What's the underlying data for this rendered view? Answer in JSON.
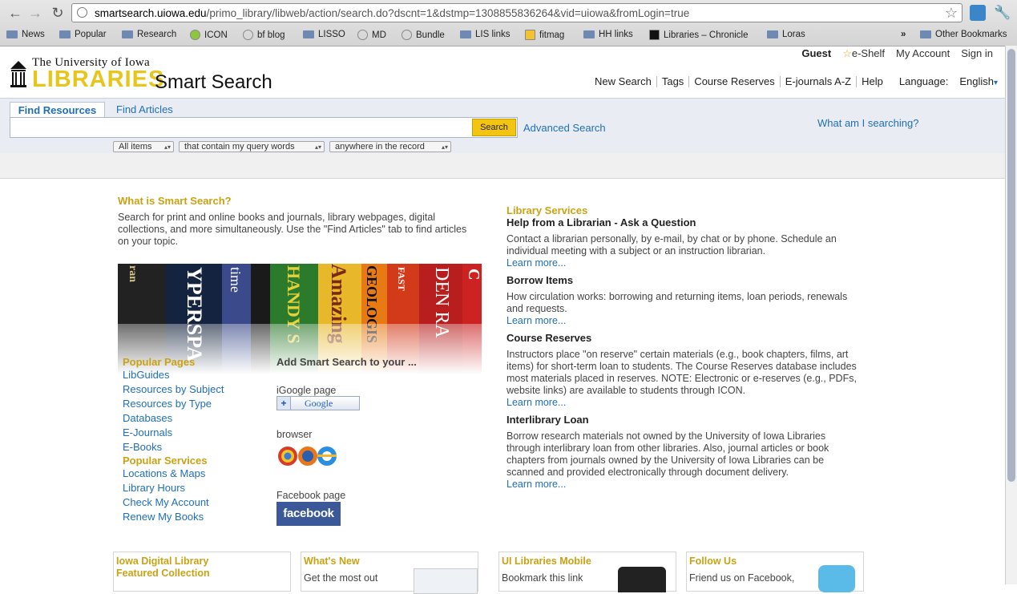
{
  "browser": {
    "url_host": "smartsearch.uiowa.edu",
    "url_rest": "/primo_library/libweb/action/search.do?dscnt=1&dstmp=1308855836264&vid=uiowa&fromLogin=true",
    "bookmarks": [
      "News",
      "Popular",
      "Research",
      "ICON",
      "bf blog",
      "LISSO",
      "MD",
      "Bundle",
      "LIS links",
      "fitmag",
      "HH links",
      "Libraries – Chronicle",
      "Loras"
    ],
    "other_bookmarks": "Other Bookmarks",
    "overflow": "»"
  },
  "header": {
    "uni_name": "The University of Iowa",
    "libraries": "LIBRARIES",
    "product": "Smart Search",
    "guest": "Guest",
    "eshelf": "e-Shelf",
    "my_account": "My Account",
    "sign_in": "Sign in",
    "nav": [
      "New Search",
      "Tags",
      "Course Reserves",
      "E-journals A-Z",
      "Help"
    ],
    "language_label": "Language:",
    "language_value": "English"
  },
  "search": {
    "tab_find": "Find Resources",
    "tab_articles": "Find Articles",
    "query": "",
    "button": "Search",
    "advanced": "Advanced Search",
    "what": "What am I searching?",
    "scope": "All items",
    "precision": "that contain my query words",
    "field": "anywhere in the record"
  },
  "intro": {
    "title": "What is Smart Search?",
    "text": "Search for print and online books and journals, library webpages, digital collections, and more simultaneously. Use the \"Find Articles\" tab to find articles on your topic."
  },
  "books": [
    "ran",
    "YPERSPA",
    "time",
    "HANDY S",
    "Amazing",
    "GEOLOGIS",
    "FAST",
    "DEN RA",
    "C"
  ],
  "popular_pages": {
    "title": "Popular Pages",
    "links": [
      "LibGuides",
      "Resources by Subject",
      "Resources by Type",
      "Databases",
      "E-Journals",
      "E-Books"
    ]
  },
  "popular_services": {
    "title": "Popular Services",
    "links": [
      "Locations & Maps",
      "Library Hours",
      "Check My Account",
      "Renew My Books"
    ]
  },
  "add_search": {
    "title": "Add Smart Search to your ...",
    "igoogle_label": "iGoogle page",
    "igoogle_button": "Google",
    "browser_label": "browser",
    "facebook_label": "Facebook page",
    "facebook_button": "facebook"
  },
  "services": {
    "title": "Library Services",
    "items": [
      {
        "heading": "Help from a Librarian - Ask a Question",
        "text": "Contact a librarian personally, by e-mail, by chat or by phone. Schedule an individual meeting with a subject or an instruction librarian.",
        "more": "Learn more..."
      },
      {
        "heading": "Borrow Items",
        "text": "How circulation works: borrowing and returning items, loan periods, renewals and requests.",
        "more": "Learn more..."
      },
      {
        "heading": "Course Reserves",
        "text": "Instructors place \"on reserve\" certain materials (e.g., book chapters, films, art items) for short-term loan to students. The Course Reserves database includes most materials placed in reserves. NOTE: Electronic or e-reserves (e.g., PDFs, website links) are available to students through ICON.",
        "more": "Learn more..."
      },
      {
        "heading": "Interlibrary Loan",
        "text": "Borrow research materials not owned by the University of Iowa Libraries through interlibrary loan from other libraries. Also, journal articles or book chapters from journals owned by the University of Iowa Libraries can be scanned and provided electronically through document delivery.",
        "more": "Learn more..."
      }
    ]
  },
  "boxes": [
    {
      "heading": "Iowa Digital Library Featured Collection",
      "text": ""
    },
    {
      "heading": "What's New",
      "text": "Get the most out"
    },
    {
      "heading": "UI Libraries Mobile",
      "text": "Bookmark this link"
    },
    {
      "heading": "Follow Us",
      "text": "Friend us on Facebook,"
    }
  ]
}
